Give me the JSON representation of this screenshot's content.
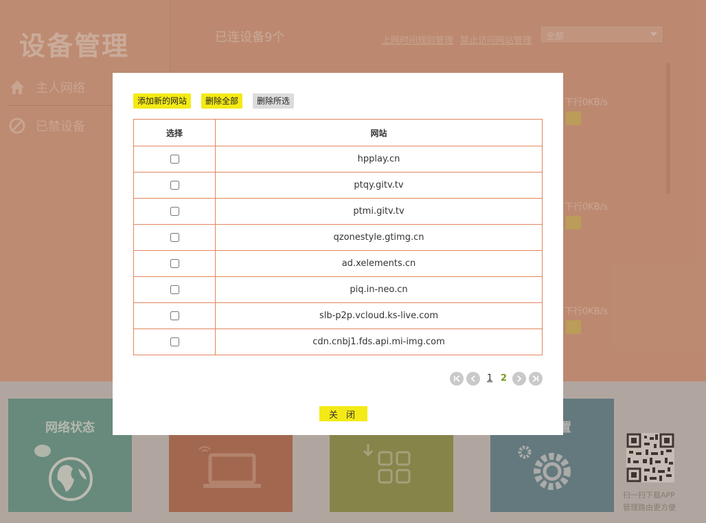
{
  "background": {
    "app_title": "设备管理",
    "nav": [
      {
        "label": "主人网络",
        "icon": "home-icon"
      },
      {
        "label": "已禁设备",
        "icon": "blocked-icon"
      }
    ],
    "connected_devices": "已连设备9个",
    "links": {
      "schedule": "上网时间规则管理",
      "blocked_sites": "禁止访问网站管理"
    },
    "filter_select": {
      "value": "全部"
    },
    "speed_labels": [
      "下行0KB/s",
      "下行0KB/s",
      "下行0KB/s"
    ],
    "tiles": [
      {
        "title": "网络状态",
        "icon": "globe-icon",
        "color": "#5fa59a"
      },
      {
        "title": "",
        "icon": "laptop-icon",
        "color": "#b97055"
      },
      {
        "title": "",
        "icon": "apps-icon",
        "color": "#8f9b4e"
      },
      {
        "title": "置",
        "icon": "gear-icon",
        "color": "#5a8b9d"
      }
    ],
    "qr_caption": [
      "扫一扫下载APP",
      "管理路由更方便"
    ]
  },
  "modal": {
    "buttons": {
      "add": "添加新的网站",
      "delete_all": "删除全部",
      "delete_selected": "删除所选"
    },
    "table": {
      "headers": [
        "选择",
        "网站"
      ],
      "rows": [
        {
          "site": "hpplay.cn",
          "checked": false
        },
        {
          "site": "ptqy.gitv.tv",
          "checked": false
        },
        {
          "site": "ptmi.gitv.tv",
          "checked": false
        },
        {
          "site": "qzonestyle.gtimg.cn",
          "checked": false
        },
        {
          "site": "ad.xelements.cn",
          "checked": false
        },
        {
          "site": "piq.in-neo.cn",
          "checked": false
        },
        {
          "site": "slb-p2p.vcloud.ks-live.com",
          "checked": false
        },
        {
          "site": "cdn.cnbj1.fds.api.mi-img.com",
          "checked": false
        }
      ]
    },
    "pagination": {
      "pages": [
        "1",
        "2"
      ],
      "current": "2",
      "first": "«",
      "prev": "‹",
      "next": "›",
      "last": "»"
    },
    "close_label": "关 闭"
  },
  "colors": {
    "accent_yellow": "#f4ea15",
    "table_border": "#e2855c",
    "bg_orange": "#e0a488"
  }
}
